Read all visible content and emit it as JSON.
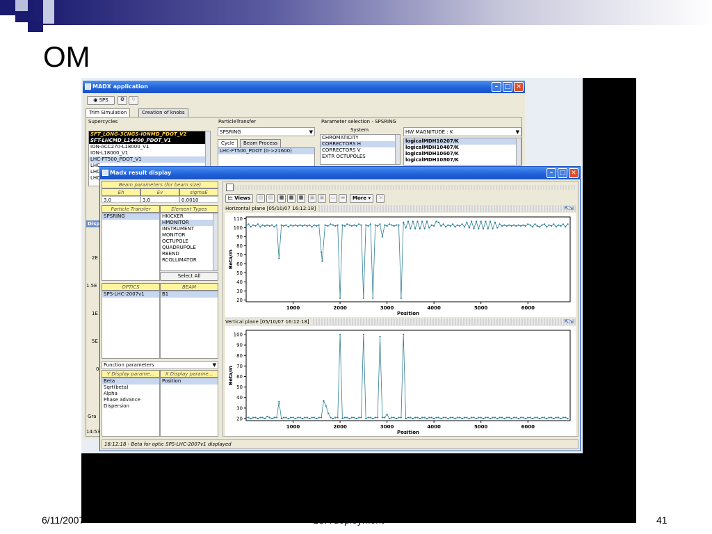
{
  "slide": {
    "title": "OM",
    "footer_date": "6/11/2007",
    "footer_center": "LSA deployment",
    "page_number": "41"
  },
  "main_window": {
    "title": "MADX application",
    "machine_label": "SPS",
    "tabs": [
      "Trim Simulation",
      "Creation of knobs"
    ],
    "supercycles_label": "Supercycles",
    "supercycles": [
      "SFT_LONG-3CNGS-IONMD_PDOT_V2",
      "SFT-LHCMD_L14400_PDOT_V1",
      "ION-ACC270-L18000_V1",
      "ION-L18000_V1",
      "LHC-FT500_PDOT_V1",
      "LHC",
      "LHC",
      "LHC"
    ],
    "particle_transfer_label": "ParticleTransfer",
    "particle_transfer_value": "SPSRING",
    "cycle_tabs": [
      "Cycle",
      "Beam Process"
    ],
    "cycle_item": "LHC-FT500_PDOT (0->21600)",
    "param_sel_label": "Parameter selection - SPSRING",
    "system_label": "System",
    "systems": [
      "CHROMATICITY",
      "CORRECTORS H",
      "CORRECTORS V",
      "EXTR OCTUPOLES"
    ],
    "hw_value": "HW MAGNITUDE : K",
    "params": [
      "logicalMDH10207/K",
      "logicalMDH10407/K",
      "logicalMDH10607/K",
      "logicalMDH10807/K"
    ],
    "left_edge_labels": [
      "Disp",
      "2E",
      "1.5E",
      "1E",
      "5E",
      "0",
      "Gra",
      "14:53"
    ]
  },
  "result_window": {
    "title": "Madx result display",
    "beam_params_header": "Beam parameters (for beam size)",
    "beam_cols": [
      "Eh",
      "Ev",
      "sigmaE"
    ],
    "beam_vals": [
      "3.0",
      "3.0",
      "0.0010"
    ],
    "pt_header": "Particle Transfer",
    "et_header": "Element Types",
    "pt_items": [
      "SPSRING"
    ],
    "element_types": [
      "HKICKER",
      "HMONITOR",
      "INSTRUMENT",
      "MONITOR",
      "OCTUPOLE",
      "QUADRUPOLE",
      "RBEND",
      "RCOLLIMATOR"
    ],
    "select_all": "Select All",
    "optics_header": "OPTICS",
    "beam_header": "BEAM",
    "optics_items": [
      "SPS-LHC-2007v1"
    ],
    "beam_items": [
      "B1"
    ],
    "function_params": "Function parameters",
    "y_display": "Y Display parame...",
    "x_display": "X Display parame...",
    "y_items": [
      "Beta",
      "Sqrt(beta)",
      "Alpha",
      "Phase advance",
      "Dispersion"
    ],
    "x_items": [
      "Position"
    ],
    "toolbar": {
      "views": "Views",
      "more": "More"
    },
    "status": "16:12:18 - Beta for optic SPS-LHC-2007v1 displayed"
  },
  "chart_data": [
    {
      "type": "line",
      "title": "Horizontal plane [05/10/07 16:12:18]",
      "xlabel": "Position",
      "ylabel": "Beta/m",
      "xlim": [
        0,
        6900
      ],
      "ylim": [
        18,
        112
      ],
      "xticks": [
        1000,
        2000,
        3000,
        4000,
        5000,
        6000
      ],
      "yticks": [
        20,
        30,
        40,
        50,
        60,
        70,
        80,
        90,
        100,
        110
      ],
      "grid": false,
      "color": "#2e7f96",
      "x": [
        0,
        50,
        100,
        150,
        200,
        250,
        300,
        350,
        400,
        450,
        500,
        550,
        600,
        650,
        700,
        750,
        800,
        850,
        900,
        950,
        1000,
        1050,
        1100,
        1150,
        1200,
        1250,
        1300,
        1350,
        1400,
        1450,
        1500,
        1550,
        1600,
        1620,
        1680,
        1740,
        1800,
        1850,
        1900,
        1950,
        2000,
        2050,
        2100,
        2150,
        2200,
        2250,
        2300,
        2350,
        2400,
        2450,
        2500,
        2550,
        2600,
        2650,
        2700,
        2750,
        2800,
        2850,
        2900,
        2950,
        3000,
        3050,
        3100,
        3150,
        3200,
        3250,
        3300,
        3350,
        3400,
        3450,
        3500,
        3550,
        3600,
        3650,
        3700,
        3750,
        3800,
        3850,
        3900,
        3950,
        4000,
        4050,
        4100,
        4150,
        4200,
        4250,
        4300,
        4350,
        4400,
        4450,
        4500,
        4550,
        4600,
        4650,
        4700,
        4750,
        4800,
        4850,
        4900,
        4950,
        5000,
        5050,
        5100,
        5150,
        5200,
        5250,
        5300,
        5350,
        5400,
        5450,
        5500,
        5550,
        5600,
        5650,
        5700,
        5750,
        5800,
        5850,
        5900,
        5950,
        6000,
        6050,
        6100,
        6150,
        6200,
        6250,
        6300,
        6350,
        6400,
        6450,
        6500,
        6550,
        6600,
        6650,
        6700,
        6750,
        6800,
        6850
      ],
      "y": [
        102,
        104,
        101,
        103,
        102,
        104,
        101,
        103,
        102,
        103,
        102,
        103,
        101,
        103,
        66,
        103,
        102,
        103,
        101,
        103,
        102,
        103,
        102,
        103,
        102,
        103,
        102,
        103,
        101,
        103,
        102,
        103,
        73,
        63,
        103,
        102,
        104,
        103,
        102,
        103,
        22,
        103,
        102,
        104,
        103,
        102,
        103,
        102,
        104,
        103,
        22,
        103,
        102,
        104,
        22,
        103,
        102,
        104,
        90,
        103,
        102,
        104,
        103,
        102,
        103,
        103,
        22,
        106,
        100,
        107,
        99,
        107,
        99,
        107,
        99,
        107,
        99,
        107,
        100,
        103,
        102,
        107,
        106,
        102,
        104,
        101,
        103,
        102,
        104,
        101,
        103,
        102,
        104,
        101,
        106,
        100,
        107,
        99,
        107,
        99,
        107,
        99,
        107,
        99,
        107,
        99,
        106,
        100,
        104,
        102,
        103,
        102,
        103,
        102,
        103,
        102,
        103,
        102,
        103,
        102,
        104,
        103,
        101,
        104,
        102,
        101,
        103,
        104,
        101,
        103,
        102,
        104,
        101,
        103,
        102,
        104,
        101,
        104
      ]
    },
    {
      "type": "line",
      "title": "Vertical plane [05/10/07 16:12:18]",
      "xlabel": "Position",
      "ylabel": "Beta/m",
      "xlim": [
        0,
        6900
      ],
      "ylim": [
        18,
        104
      ],
      "xticks": [
        1000,
        2000,
        3000,
        4000,
        5000,
        6000
      ],
      "yticks": [
        20,
        30,
        40,
        50,
        60,
        70,
        80,
        90,
        100
      ],
      "grid": false,
      "color": "#2e7f96",
      "x": [
        0,
        50,
        100,
        150,
        200,
        250,
        300,
        350,
        400,
        450,
        500,
        550,
        600,
        650,
        700,
        750,
        800,
        850,
        900,
        950,
        1000,
        1050,
        1100,
        1150,
        1200,
        1250,
        1300,
        1350,
        1400,
        1450,
        1500,
        1550,
        1600,
        1650,
        1700,
        1750,
        1800,
        1850,
        1900,
        1950,
        2000,
        2050,
        2100,
        2150,
        2200,
        2250,
        2300,
        2350,
        2400,
        2450,
        2500,
        2550,
        2600,
        2650,
        2700,
        2750,
        2800,
        2850,
        2900,
        2950,
        3000,
        3050,
        3100,
        3150,
        3200,
        3250,
        3300,
        3350,
        3400,
        3450,
        3500,
        3550,
        3600,
        3650,
        3700,
        3750,
        3800,
        3850,
        3900,
        3950,
        4000,
        4050,
        4100,
        4150,
        4200,
        4250,
        4300,
        4350,
        4400,
        4450,
        4500,
        4550,
        4600,
        4650,
        4700,
        4750,
        4800,
        4850,
        4900,
        4950,
        5000,
        5050,
        5100,
        5150,
        5200,
        5250,
        5300,
        5350,
        5400,
        5450,
        5500,
        5550,
        5600,
        5650,
        5700,
        5750,
        5800,
        5850,
        5900,
        5950,
        6000,
        6050,
        6100,
        6150,
        6200,
        6250,
        6300,
        6350,
        6400,
        6450,
        6500,
        6550,
        6600,
        6650,
        6700,
        6750,
        6800,
        6850
      ],
      "y": [
        21,
        21,
        20,
        21,
        21,
        20,
        21,
        21,
        20,
        22,
        21,
        20,
        21,
        21,
        36,
        20,
        21,
        21,
        20,
        21,
        21,
        20,
        21,
        21,
        20,
        21,
        21,
        20,
        21,
        21,
        20,
        21,
        21,
        37,
        32,
        25,
        21,
        20,
        21,
        21,
        100,
        20,
        21,
        21,
        20,
        21,
        21,
        20,
        21,
        21,
        100,
        20,
        21,
        21,
        20,
        21,
        21,
        98,
        21,
        21,
        24,
        20,
        21,
        21,
        20,
        21,
        21,
        100,
        20,
        21,
        21,
        20,
        21,
        21,
        20,
        21,
        21,
        20,
        21,
        21,
        20,
        21,
        21,
        20,
        21,
        21,
        20,
        21,
        21,
        20,
        21,
        21,
        20,
        21,
        21,
        20,
        21,
        21,
        20,
        21,
        21,
        20,
        21,
        21,
        20,
        21,
        21,
        20,
        21,
        21,
        20,
        21,
        21,
        20,
        21,
        21,
        20,
        21,
        21,
        20,
        21,
        21,
        20,
        21,
        21,
        20,
        21,
        21,
        20,
        21,
        21,
        20,
        21,
        21,
        20,
        21,
        21,
        20
      ]
    }
  ]
}
